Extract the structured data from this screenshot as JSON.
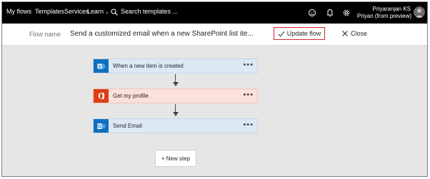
{
  "nav": {
    "my_flows": "My flows",
    "templates": "Templates",
    "services": "Services",
    "learn": "Learn",
    "search_placeholder": "Search templates ..."
  },
  "user": {
    "name": "Priyaranjan KS",
    "subtitle": "Priyan (from preview)"
  },
  "header": {
    "flow_label": "Flow name",
    "flow_name": "Send a customized email when a new SharePoint list ite...",
    "update_label": "Update flow",
    "close_label": "Close"
  },
  "steps": [
    {
      "label": "When a new item is created",
      "icon": "sharepoint-icon",
      "color": "#0f6fbf"
    },
    {
      "label": "Get my profile",
      "icon": "office-icon",
      "color": "#dc3e15"
    },
    {
      "label": "Send Email",
      "icon": "outlook-icon",
      "color": "#0f6fbf"
    }
  ],
  "new_step_label": "+ New step",
  "colors": {
    "topbar": "#000000",
    "update_border": "#d7262f",
    "step_blue": "#dce9f5",
    "step_orange": "#fbe1d9"
  }
}
